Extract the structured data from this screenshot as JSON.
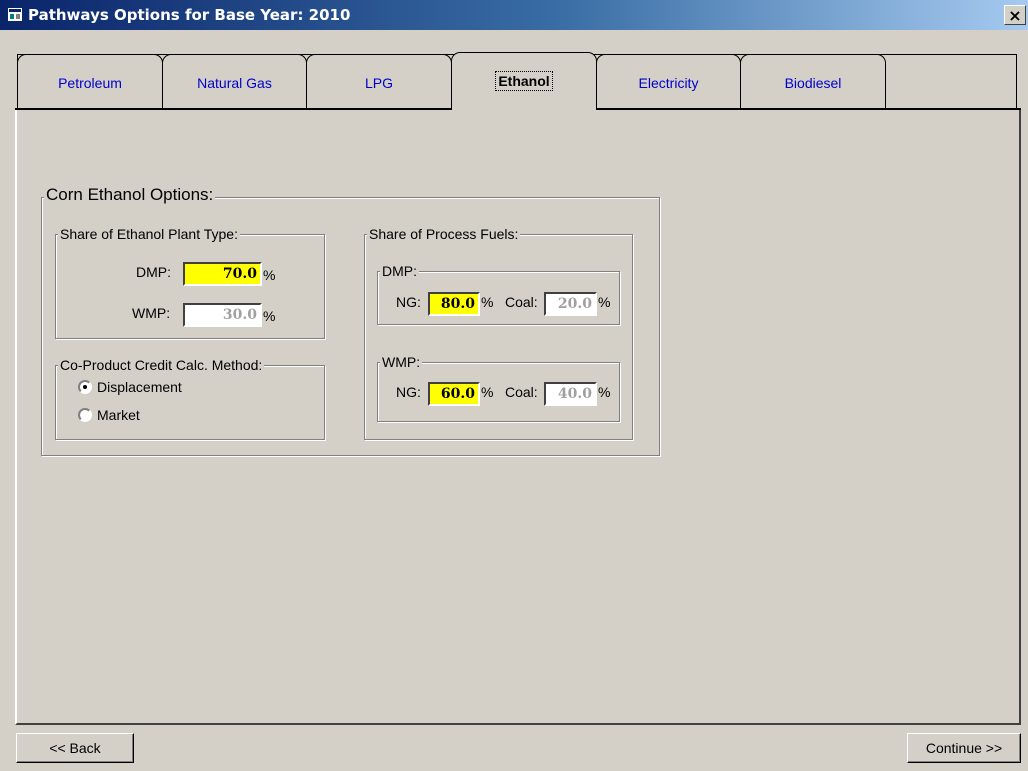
{
  "window": {
    "title": "Pathways Options for Base Year: 2010",
    "close_label": "×"
  },
  "tabs": [
    {
      "label": "Petroleum",
      "active": false
    },
    {
      "label": "Natural Gas",
      "active": false
    },
    {
      "label": "LPG",
      "active": false
    },
    {
      "label": "Ethanol",
      "active": true
    },
    {
      "label": "Electricity",
      "active": false
    },
    {
      "label": "Biodiesel",
      "active": false
    }
  ],
  "corn_ethanol": {
    "title": "Corn Ethanol Options:",
    "plant_type": {
      "title": "Share of Ethanol Plant Type:",
      "dmp_label": "DMP:",
      "dmp_value": "70.0",
      "wmp_label": "WMP:",
      "wmp_value": "30.0",
      "unit": "%"
    },
    "coproduct": {
      "title": "Co-Product Credit Calc. Method:",
      "options": [
        {
          "label": "Displacement",
          "selected": true
        },
        {
          "label": "Market",
          "selected": false
        }
      ]
    },
    "process_fuels": {
      "title": "Share of Process Fuels:",
      "dmp": {
        "title": "DMP:",
        "ng_label": "NG:",
        "ng_value": "80.0",
        "coal_label": "Coal:",
        "coal_value": "20.0"
      },
      "wmp": {
        "title": "WMP:",
        "ng_label": "NG:",
        "ng_value": "60.0",
        "coal_label": "Coal:",
        "coal_value": "40.0"
      },
      "unit": "%"
    }
  },
  "buttons": {
    "back": "<< Back",
    "continue": "Continue >>"
  },
  "colors": {
    "highlight_field": "#ffff00",
    "titlebar": "#0a246a",
    "tab_link": "#0000cc"
  }
}
